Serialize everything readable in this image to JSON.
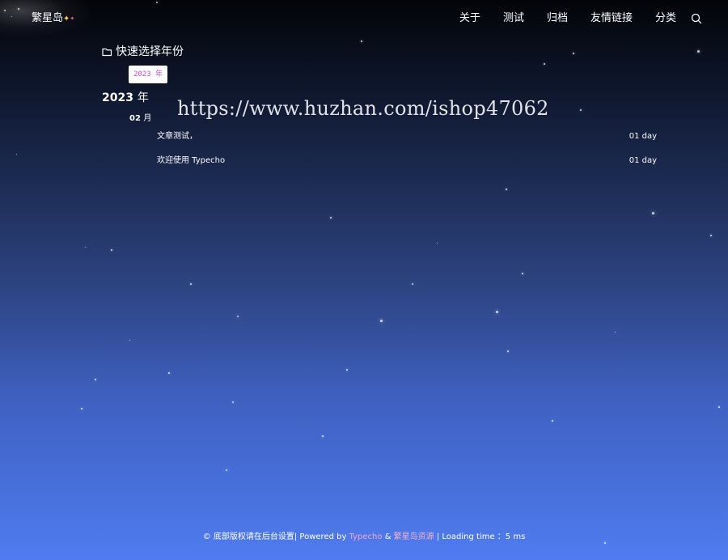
{
  "header": {
    "brand": "繁星岛",
    "nav": [
      "关于",
      "测试",
      "归档",
      "友情链接",
      "分类"
    ]
  },
  "archive": {
    "heading": "快速选择年份",
    "year_chip": "2023 年",
    "year": "2023",
    "year_unit": "年",
    "month": "02",
    "month_unit": "月",
    "posts": [
      {
        "title": "文章测试，",
        "age": "01 day"
      },
      {
        "title": "欢迎使用 Typecho",
        "age": "01 day"
      }
    ]
  },
  "watermark": "https://www.huzhan.com/ishop47062",
  "footer": {
    "copyright": "© 底部版权请在后台设置| Powered by ",
    "typecho": "Typecho",
    "amp": " & ",
    "site": "繁星岛资源",
    "loading": " | Loading time ：5 ms"
  },
  "colors": {
    "chip_text": "#c04ad8",
    "footer_link": "#f2a7d8",
    "bg_top": "#030408",
    "bg_bottom": "#4f7cf0"
  },
  "icons": [
    "folder-icon",
    "search-icon",
    "sparkle-icon"
  ]
}
